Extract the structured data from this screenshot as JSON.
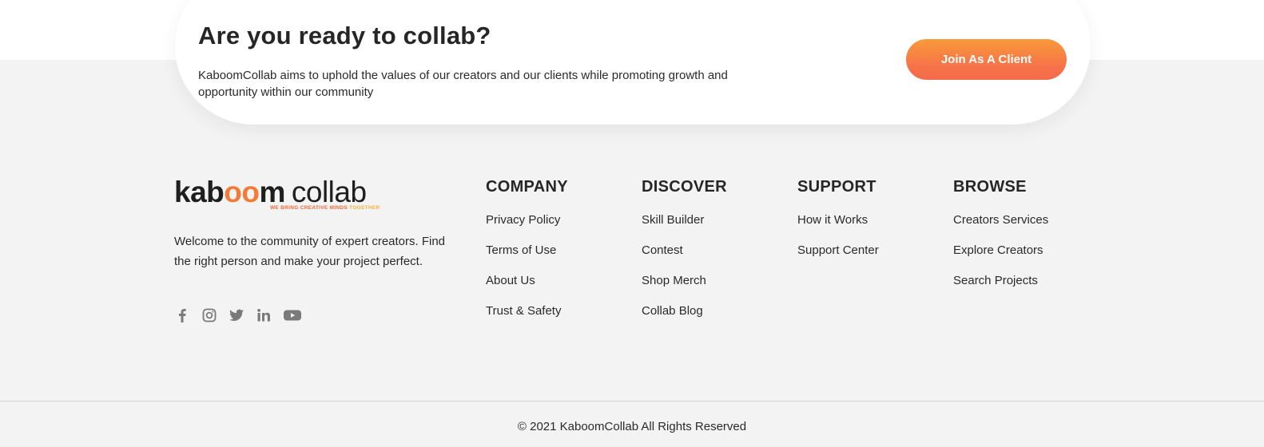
{
  "cta": {
    "title": "Are you ready to collab?",
    "text": "KaboomCollab aims to uphold the values of our creators and our clients while promoting growth and opportunity within our community",
    "button_label": "Join As A Client"
  },
  "brand": {
    "name_part1": "kab",
    "name_part2": "oo",
    "name_part3": "m",
    "name_part4": "collab",
    "tagline_main": "WE BRING CREATIVE MINDS ",
    "tagline_end": "TOGETHER",
    "welcome": "Welcome to the community of expert creators. Find the right person and make your project perfect.",
    "accent_color": "#f47a3a"
  },
  "social": [
    {
      "icon": "facebook-icon"
    },
    {
      "icon": "instagram-icon"
    },
    {
      "icon": "twitter-icon"
    },
    {
      "icon": "linkedin-icon"
    },
    {
      "icon": "youtube-icon"
    }
  ],
  "footer": {
    "company": {
      "heading": "COMPANY",
      "links": [
        "Privacy Policy",
        "Terms of Use",
        "About Us",
        "Trust & Safety"
      ]
    },
    "discover": {
      "heading": "DISCOVER",
      "links": [
        "Skill Builder",
        "Contest",
        "Shop Merch",
        "Collab Blog"
      ]
    },
    "support": {
      "heading": "SUPPORT",
      "links": [
        "How it Works",
        "Support Center"
      ]
    },
    "browse": {
      "heading": "BROWSE",
      "links": [
        "Creators Services",
        "Explore Creators",
        "Search Projects"
      ]
    },
    "copyright": "© 2021 KaboomCollab All Rights Reserved"
  }
}
